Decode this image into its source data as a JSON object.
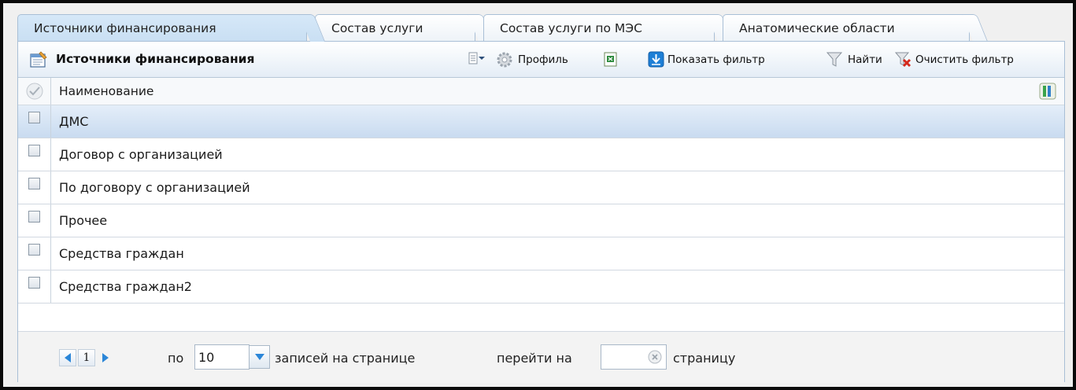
{
  "tabs": [
    {
      "label": "Источники финансирования",
      "active": true
    },
    {
      "label": "Состав услуги",
      "active": false
    },
    {
      "label": "Состав услуги по МЭС",
      "active": false
    },
    {
      "label": "Анатомические области",
      "active": false
    }
  ],
  "panel": {
    "title": "Источники финансирования",
    "toolbar": {
      "menu_icon": "list-dropdown-icon",
      "profile": "Профиль",
      "excel_icon": "excel-export-icon",
      "show_filter": "Показать фильтр",
      "find": "Найти",
      "clear_filter": "Очистить фильтр"
    }
  },
  "grid": {
    "column_header": "Наименование",
    "rows": [
      {
        "name": "ДМС",
        "selected": true
      },
      {
        "name": "Договор с организацией",
        "selected": false
      },
      {
        "name": "По договору с организацией",
        "selected": false
      },
      {
        "name": "Прочее",
        "selected": false
      },
      {
        "name": "Средства граждан",
        "selected": false
      },
      {
        "name": "Средства граждан2",
        "selected": false
      }
    ]
  },
  "pager": {
    "page": "1",
    "per_page_prefix": "по",
    "per_page_value": "10",
    "per_page_suffix": "записей на странице",
    "goto_prefix": "перейти на",
    "goto_value": "",
    "goto_suffix": "страницу"
  },
  "colors": {
    "accent": "#1e7fd6",
    "selected_row": "#c9dbf0",
    "border": "#a9bfd6"
  }
}
